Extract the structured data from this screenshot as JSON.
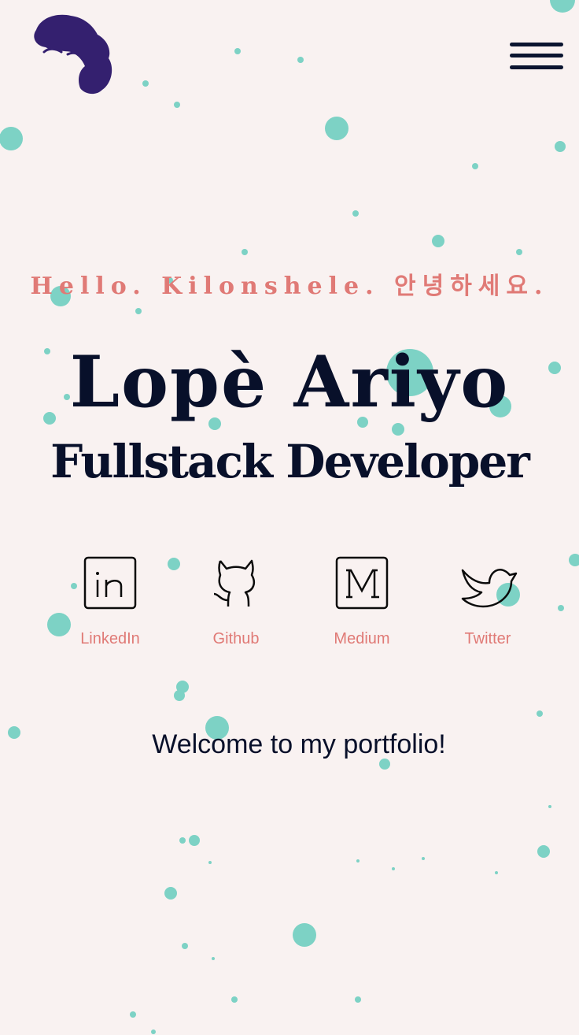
{
  "header": {
    "menu_icon": "hamburger-menu-icon",
    "logo_icon": "hair-avatar-logo-icon",
    "logo_color": "#34206f"
  },
  "hero": {
    "greeting": "Hello. Kilonshele. 안녕하세요.",
    "name": "Lopè Ariyo",
    "role": "Fullstack Developer"
  },
  "social": [
    {
      "label": "LinkedIn",
      "icon": "linkedin-icon"
    },
    {
      "label": "Github",
      "icon": "github-icon"
    },
    {
      "label": "Medium",
      "icon": "medium-icon"
    },
    {
      "label": "Twitter",
      "icon": "twitter-bird-icon"
    }
  ],
  "welcome": "Welcome to my portfolio!",
  "colors": {
    "background": "#f9f2f1",
    "accent": "#e07a76",
    "text": "#08102a",
    "dots": "#7dd2c5"
  }
}
